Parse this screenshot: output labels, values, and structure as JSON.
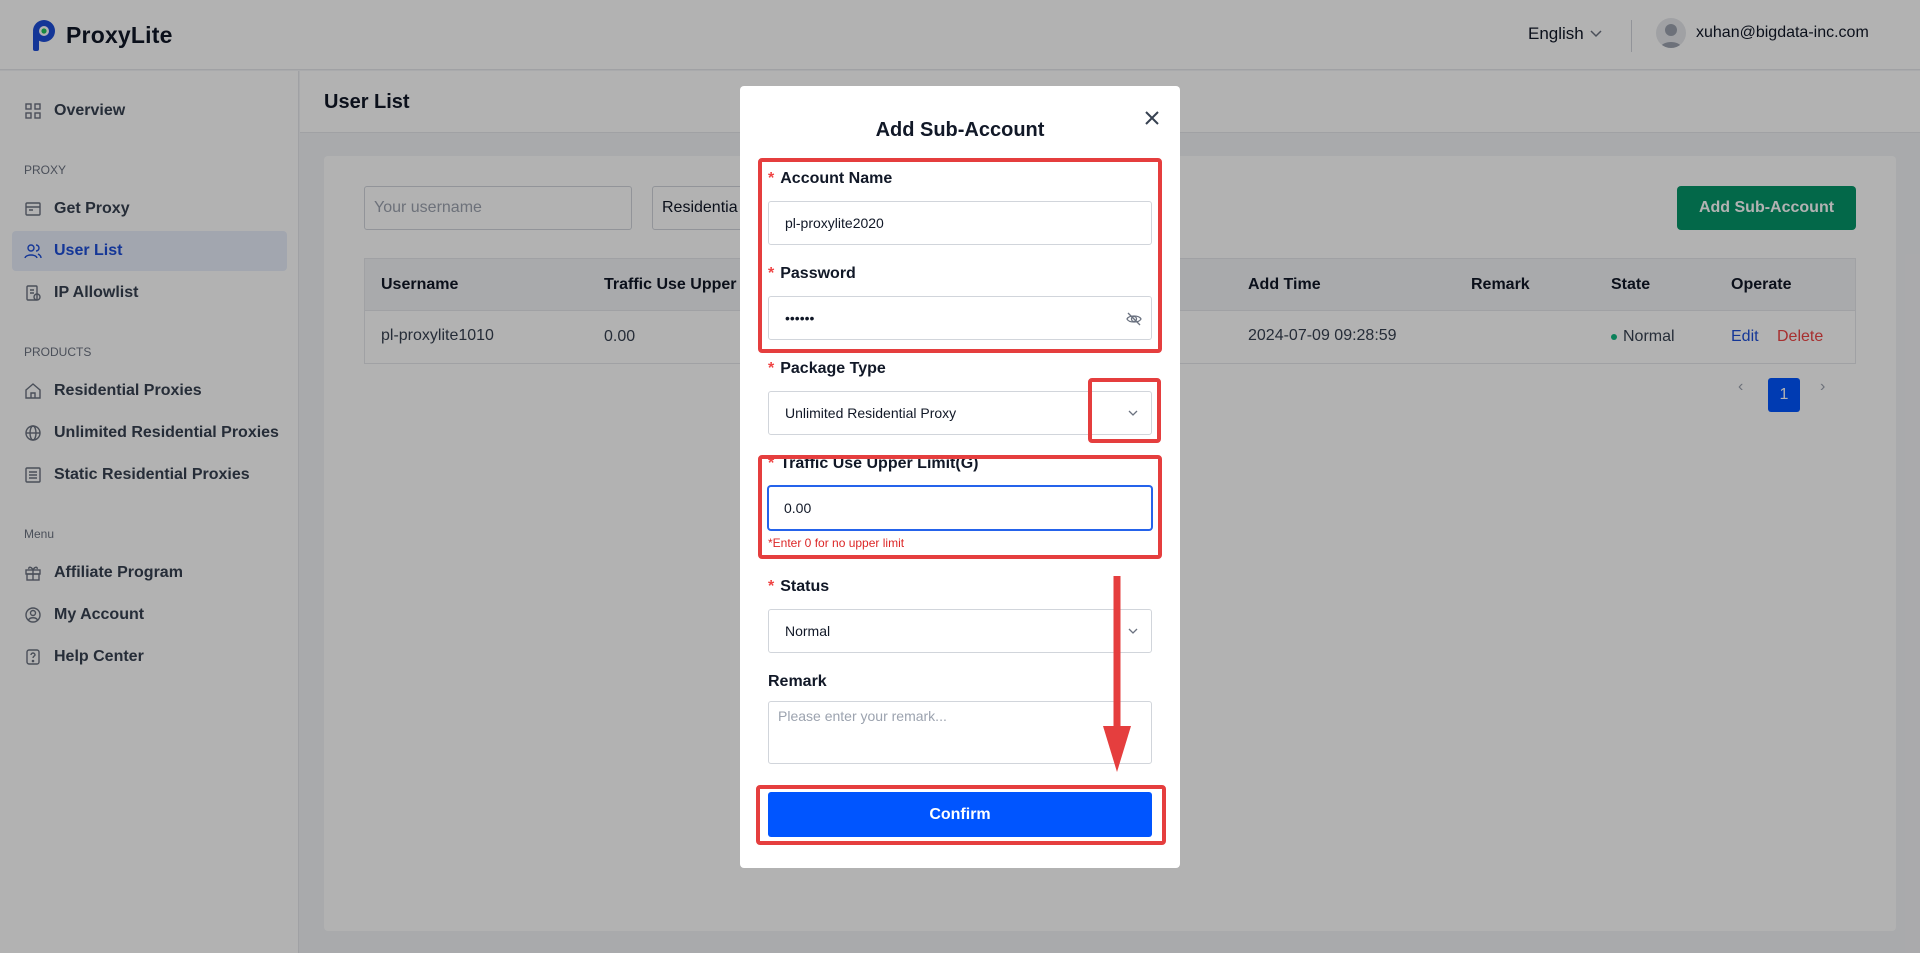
{
  "brand": {
    "name": "ProxyLite",
    "color": "#1d4ed8"
  },
  "header": {
    "language": "English",
    "user_email": "xuhan@bigdata-inc.com"
  },
  "sidebar": {
    "items": [
      {
        "label": "Overview",
        "icon": "grid-icon"
      },
      {
        "label": "Get Proxy",
        "icon": "window-icon"
      },
      {
        "label": "User List",
        "icon": "users-icon",
        "active": true
      },
      {
        "label": "IP Allowlist",
        "icon": "document-icon"
      },
      {
        "label": "Residential Proxies",
        "icon": "home-icon"
      },
      {
        "label": "Unlimited Residential Proxies",
        "icon": "globe-icon"
      },
      {
        "label": "Static Residential Proxies",
        "icon": "list-icon"
      },
      {
        "label": "Affiliate Program",
        "icon": "gift-icon"
      },
      {
        "label": "My Account",
        "icon": "user-circle-icon"
      },
      {
        "label": "Help Center",
        "icon": "help-icon"
      }
    ],
    "sections": [
      "PROXY",
      "PRODUCTS",
      "Menu"
    ]
  },
  "page": {
    "title": "User List"
  },
  "filters": {
    "username_placeholder": "Your username",
    "package_value": "Residentia"
  },
  "add_button": "Add Sub-Account",
  "table": {
    "headers": [
      "Username",
      "Traffic Use Upper",
      "Add Time",
      "Remark",
      "State",
      "Operate"
    ],
    "rows": [
      {
        "username": "pl-proxylite1010",
        "traffic": "0.00",
        "add_time": "2024-07-09 09:28:59",
        "remark": "",
        "state": "Normal",
        "edit": "Edit",
        "delete": "Delete"
      }
    ]
  },
  "pagination": {
    "current": "1",
    "prev": "‹",
    "next": "›"
  },
  "modal": {
    "title": "Add Sub-Account",
    "account_name_label": "Account Name",
    "account_name_value": "pl-proxylite2020",
    "password_label": "Password",
    "password_value": "••••••",
    "package_label": "Package Type",
    "package_value": "Unlimited Residential Proxy",
    "traffic_label": "Traffic Use Upper Limit(G)",
    "traffic_value": "0.00",
    "traffic_hint": "*Enter 0 for no upper limit",
    "status_label": "Status",
    "status_value": "Normal",
    "remark_label": "Remark",
    "remark_placeholder": "Please enter your remark...",
    "confirm_label": "Confirm",
    "required_mark": "*"
  },
  "colors": {
    "primary": "#0055ff",
    "success": "#059669",
    "danger": "#ef4444",
    "annotation": "#e53e3e"
  }
}
